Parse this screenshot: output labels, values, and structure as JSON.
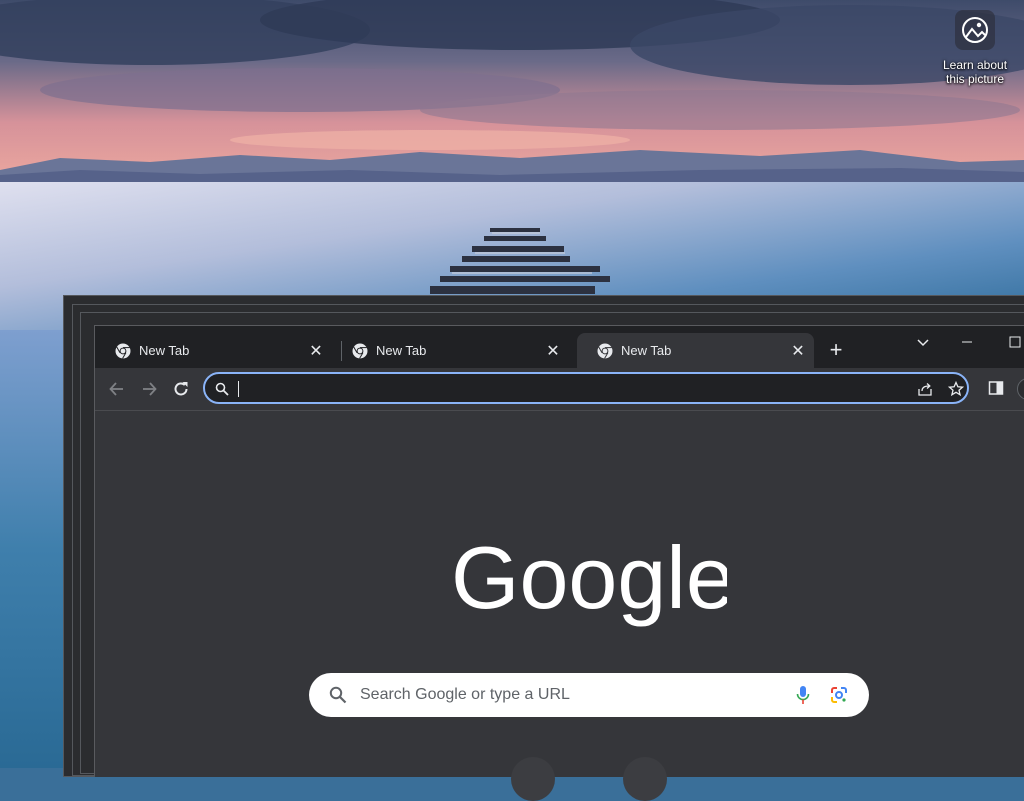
{
  "desktop": {
    "spotlight_label_line1": "Learn about",
    "spotlight_label_line2": "this picture",
    "spotlight_icon": "picture-info-icon"
  },
  "browser": {
    "tabs": [
      {
        "title": "New Tab",
        "active": false
      },
      {
        "title": "New Tab",
        "active": false
      },
      {
        "title": "New Tab",
        "active": true
      }
    ],
    "new_tab_icon": "plus-icon",
    "window_controls": [
      "tab-search-icon",
      "minimize-icon",
      "maximize-icon"
    ],
    "address_bar": {
      "value": "",
      "focused": true
    },
    "toolbar_icons": [
      "back-arrow-icon",
      "forward-arrow-icon",
      "reload-icon",
      "share-icon",
      "bookmark-star-icon",
      "side-panel-icon"
    ],
    "ntp": {
      "logo_text": "Google",
      "search_placeholder": "Search Google or type a URL"
    }
  },
  "colors": {
    "tabstrip_bg": "#202124",
    "toolbar_bg": "#35363a",
    "omnibox_focus": "#8ab4f8",
    "ntp_bg": "#35363a",
    "logo": "#ffffff"
  }
}
